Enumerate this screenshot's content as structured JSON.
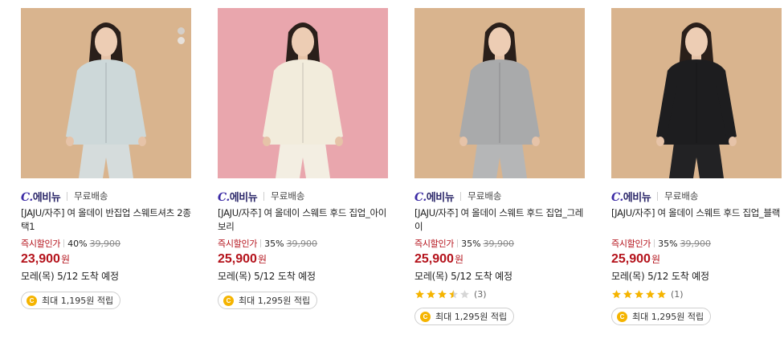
{
  "products": [
    {
      "brand": "에비뉴",
      "brand_mark": "C.",
      "shipping": "무료배송",
      "title": "[JAJU/자주] 여 올데이 반집업 스웨트셔츠 2종택1",
      "discount_label": "즉시할인가",
      "discount_rate": "40%",
      "original_price": "39,900",
      "price": "23,900",
      "currency": "원",
      "delivery": "모레(목) 5/12 도착 예정",
      "points": "최대 1,195원 적립",
      "background": "#d9b48e",
      "garment": "#cdd8d9",
      "pants": "#d5dcdc"
    },
    {
      "brand": "에비뉴",
      "brand_mark": "C.",
      "shipping": "무료배송",
      "title": "[JAJU/자주] 여 올데이 스웨트 후드 집업_아이보리",
      "discount_label": "즉시할인가",
      "discount_rate": "35%",
      "original_price": "39,900",
      "price": "25,900",
      "currency": "원",
      "delivery": "모레(목) 5/12 도착 예정",
      "points": "최대 1,295원 적립",
      "background": "#e9a6ad",
      "garment": "#f2ecdc",
      "pants": "#f3eee2"
    },
    {
      "brand": "에비뉴",
      "brand_mark": "C.",
      "shipping": "무료배송",
      "title": "[JAJU/자주] 여 올데이 스웨트 후드 집업_그레이",
      "discount_label": "즉시할인가",
      "discount_rate": "35%",
      "original_price": "39,900",
      "price": "25,900",
      "currency": "원",
      "delivery": "모레(목) 5/12 도착 예정",
      "rating": 3.5,
      "review_count": "(3)",
      "points": "최대 1,295원 적립",
      "background": "#d9b48e",
      "garment": "#a9aaab",
      "pants": "#b5b6b7"
    },
    {
      "brand": "에비뉴",
      "brand_mark": "C.",
      "shipping": "무료배송",
      "title": "[JAJU/자주] 여 올데이 스웨트 후드 집업_블랙",
      "discount_label": "즉시할인가",
      "discount_rate": "35%",
      "original_price": "39,900",
      "price": "25,900",
      "currency": "원",
      "delivery": "모레(목) 5/12 도착 예정",
      "rating": 5,
      "review_count": "(1)",
      "points": "최대 1,295원 적립",
      "background": "#d9b48e",
      "garment": "#1d1d1f",
      "pants": "#222224"
    }
  ],
  "colors": {
    "sale_red": "#b4121b",
    "brand_navy": "#2b2769",
    "star_gold": "#f5b400",
    "star_empty": "#d6d6d6"
  }
}
